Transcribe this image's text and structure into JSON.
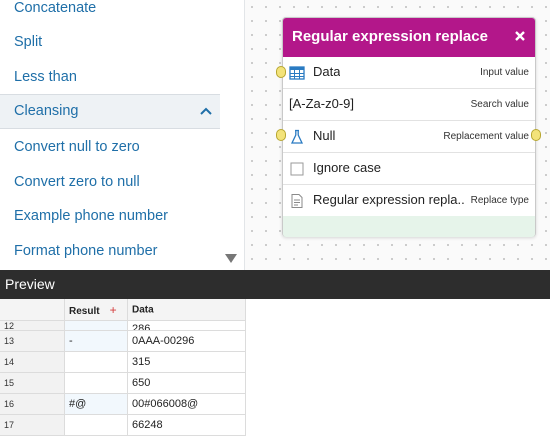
{
  "sidebar": {
    "items_top": [
      "Concatenate",
      "Split",
      "Less than"
    ],
    "section": "Cleansing",
    "items_bottom": [
      "Convert null to zero",
      "Convert zero to null",
      "Example phone number",
      "Format phone number"
    ]
  },
  "node": {
    "title": "Regular expression replace",
    "accent_color": "#b3178a",
    "rows": [
      {
        "main": "Data",
        "label": "Input value",
        "icon": "table-icon"
      },
      {
        "main": "[A-Za-z0-9]",
        "label": "Search value",
        "icon": ""
      },
      {
        "main": "Null",
        "label": "Replacement value",
        "icon": "flask-icon"
      },
      {
        "main": "Ignore case",
        "label": "",
        "icon": "checkbox-icon"
      },
      {
        "main": "Regular expression repla...",
        "label": "Replace type",
        "icon": "document-icon"
      }
    ]
  },
  "preview": {
    "title": "Preview",
    "columns": [
      "Result",
      "Data"
    ],
    "rows": [
      {
        "num": "12",
        "result": "",
        "data": "286"
      },
      {
        "num": "13",
        "result": "-",
        "data": "0AAA-00296"
      },
      {
        "num": "14",
        "result": "",
        "data": "315"
      },
      {
        "num": "15",
        "result": "",
        "data": "650"
      },
      {
        "num": "16",
        "result": "#@",
        "data": "00#066008@"
      },
      {
        "num": "17",
        "result": "",
        "data": "66248"
      }
    ]
  }
}
